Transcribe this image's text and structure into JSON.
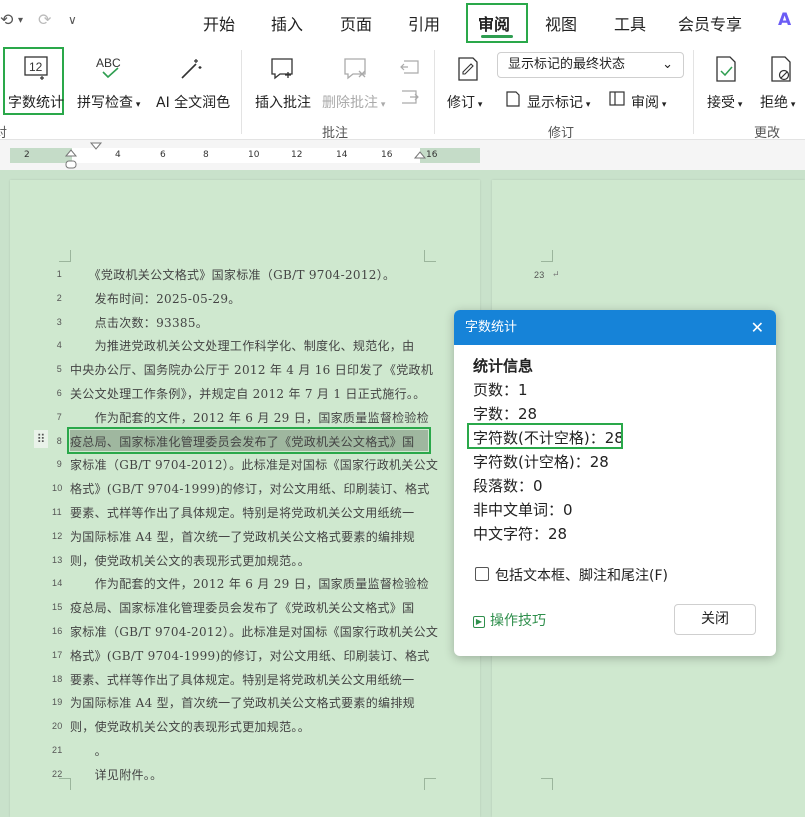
{
  "quick_access": {
    "undo_icon": "undo-icon",
    "redo_icon": "redo-icon",
    "more_icon": "chevron-down-icon"
  },
  "menu": {
    "items": [
      "开始",
      "插入",
      "页面",
      "引用",
      "审阅",
      "视图",
      "工具",
      "会员专享"
    ],
    "active": "审阅",
    "accent": "#2f9e51"
  },
  "ribbon": {
    "word_count": "字数统计",
    "word_count_icon_text": "12",
    "spell_check": "拼写检查",
    "spell_check_icon_text": "ABC",
    "ai_polish": "AI 全文润色",
    "insert_comment": "插入批注",
    "delete_comment": "删除批注",
    "comments_group": "批注",
    "left_group_fragment": "对",
    "markup_dropdown": "显示标记的最终状态",
    "revise": "修订",
    "show_markup": "显示标记",
    "review_pane": "审阅",
    "revise_group": "修订",
    "accept": "接受",
    "reject": "拒绝",
    "change_group": "更改"
  },
  "ruler": {
    "numbers": [
      "2",
      "2",
      "4",
      "6",
      "8",
      "10",
      "12",
      "14",
      "16"
    ]
  },
  "document": {
    "lines": [
      {
        "n": "1",
        "t": "　　《党政机关公文格式》国家标准（GB/T 9704-2012）。"
      },
      {
        "n": "2",
        "t": "　　发布时间：2025-05-29。"
      },
      {
        "n": "3",
        "t": "　　点击次数：93385。"
      },
      {
        "n": "4",
        "t": "　　为推进党政机关公文处理工作科学化、制度化、规范化，由"
      },
      {
        "n": "5",
        "t": "中央办公厅、国务院办公厅于 2012 年 4 月 16 日印发了《党政机"
      },
      {
        "n": "6",
        "t": "关公文处理工作条例》，并规定自 2012 年 7 月 1 日正式施行。。"
      },
      {
        "n": "7",
        "t": "　　作为配套的文件，2012 年 6 月 29 日，国家质量监督检验检"
      },
      {
        "n": "8",
        "t": "疫总局、国家标准化管理委员会发布了《党政机关公文格式》国"
      },
      {
        "n": "9",
        "t": "家标准（GB/T 9704-2012）。此标准是对国标《国家行政机关公文"
      },
      {
        "n": "10",
        "t": "格式》(GB/T 9704-1999)的修订，对公文用纸、印刷装订、格式"
      },
      {
        "n": "11",
        "t": "要素、式样等作出了具体规定。特别是将党政机关公文用纸统一"
      },
      {
        "n": "12",
        "t": "为国际标准 A4 型，首次统一了党政机关公文格式要素的编排规"
      },
      {
        "n": "13",
        "t": "则，使党政机关公文的表现形式更加规范。。"
      },
      {
        "n": "14",
        "t": "　　作为配套的文件，2012 年 6 月 29 日，国家质量监督检验检"
      },
      {
        "n": "15",
        "t": "疫总局、国家标准化管理委员会发布了《党政机关公文格式》国"
      },
      {
        "n": "16",
        "t": "家标准（GB/T 9704-2012）。此标准是对国标《国家行政机关公文"
      },
      {
        "n": "17",
        "t": "格式》(GB/T 9704-1999)的修订，对公文用纸、印刷装订、格式"
      },
      {
        "n": "18",
        "t": "要素、式样等作出了具体规定。特别是将党政机关公文用纸统一"
      },
      {
        "n": "19",
        "t": "为国际标准 A4 型，首次统一了党政机关公文格式要素的编排规"
      },
      {
        "n": "20",
        "t": "则，使党政机关公文的表现形式更加规范。。"
      },
      {
        "n": "21",
        "t": "　　。"
      },
      {
        "n": "22",
        "t": "　　详见附件。。"
      }
    ],
    "page2_line_number": "23",
    "page2_line_text": "↵"
  },
  "dialog": {
    "title": "字数统计",
    "section": "统计信息",
    "pages": "页数：1",
    "words": "字数：28",
    "chars_no_space": "字符数(不计空格)：28",
    "chars_space": "字符数(计空格)：28",
    "paragraphs": "段落数：0",
    "non_chinese_words": "非中文单词：0",
    "chinese_chars": "中文字符：28",
    "include_label": "包括文本框、脚注和尾注(F)",
    "include_checked": false,
    "tips": "操作技巧",
    "close": "关闭",
    "header_color": "#1683d8"
  }
}
